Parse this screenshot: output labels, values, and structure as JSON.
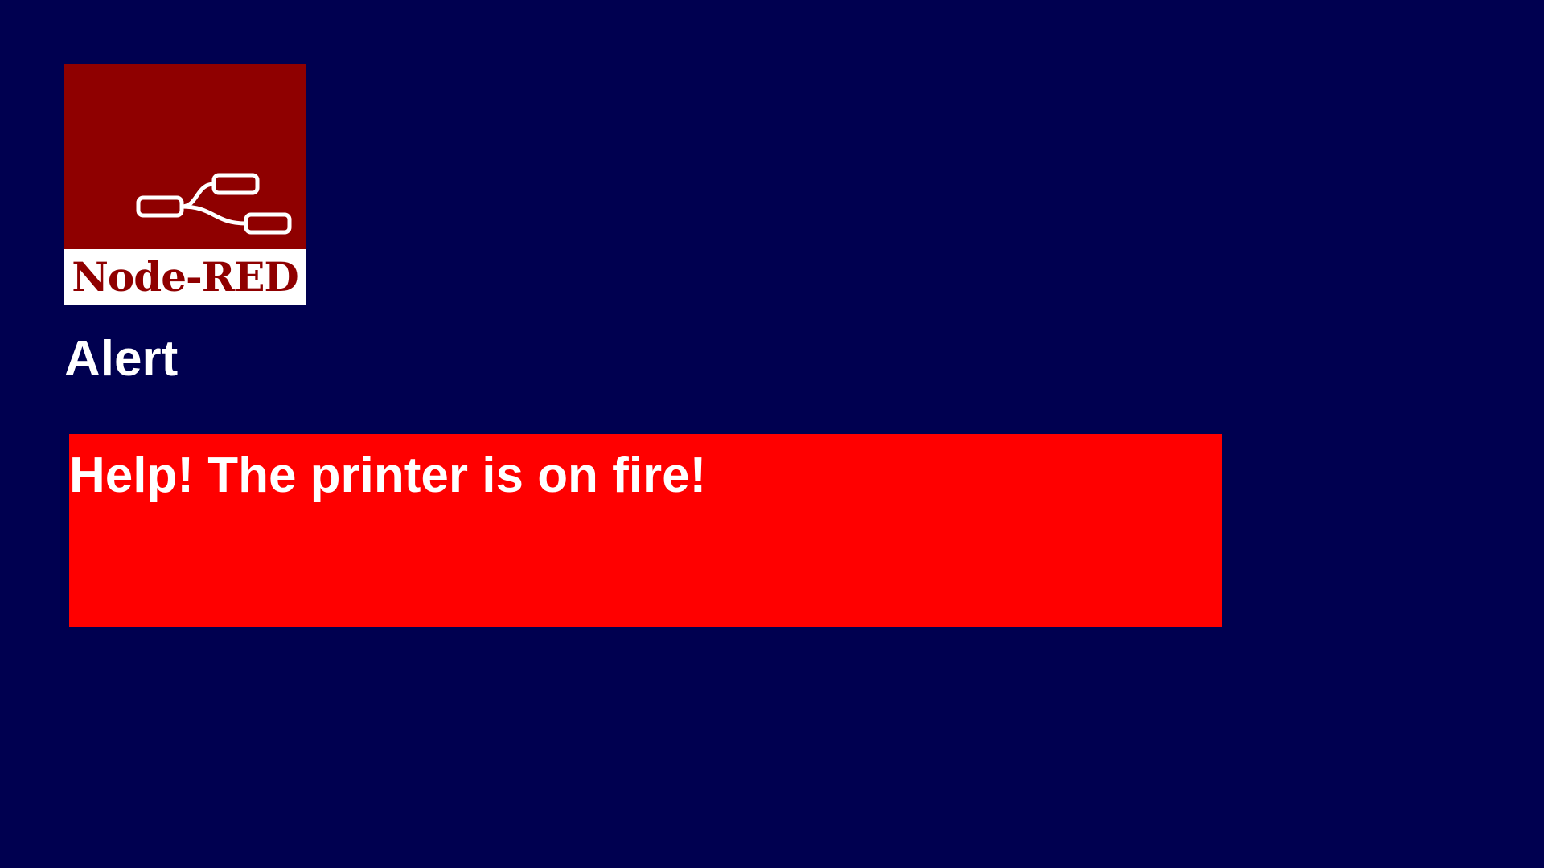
{
  "theme": {
    "background": "#000050",
    "logo_red": "#8f0000",
    "alert_red": "#ff0000",
    "text": "#ffffff"
  },
  "logo": {
    "text": "Node-RED",
    "icon": "node-red-flow-icon"
  },
  "page": {
    "title": "Alert"
  },
  "alert": {
    "message": "Help! The printer is on fire!",
    "color": "#ff0000"
  }
}
